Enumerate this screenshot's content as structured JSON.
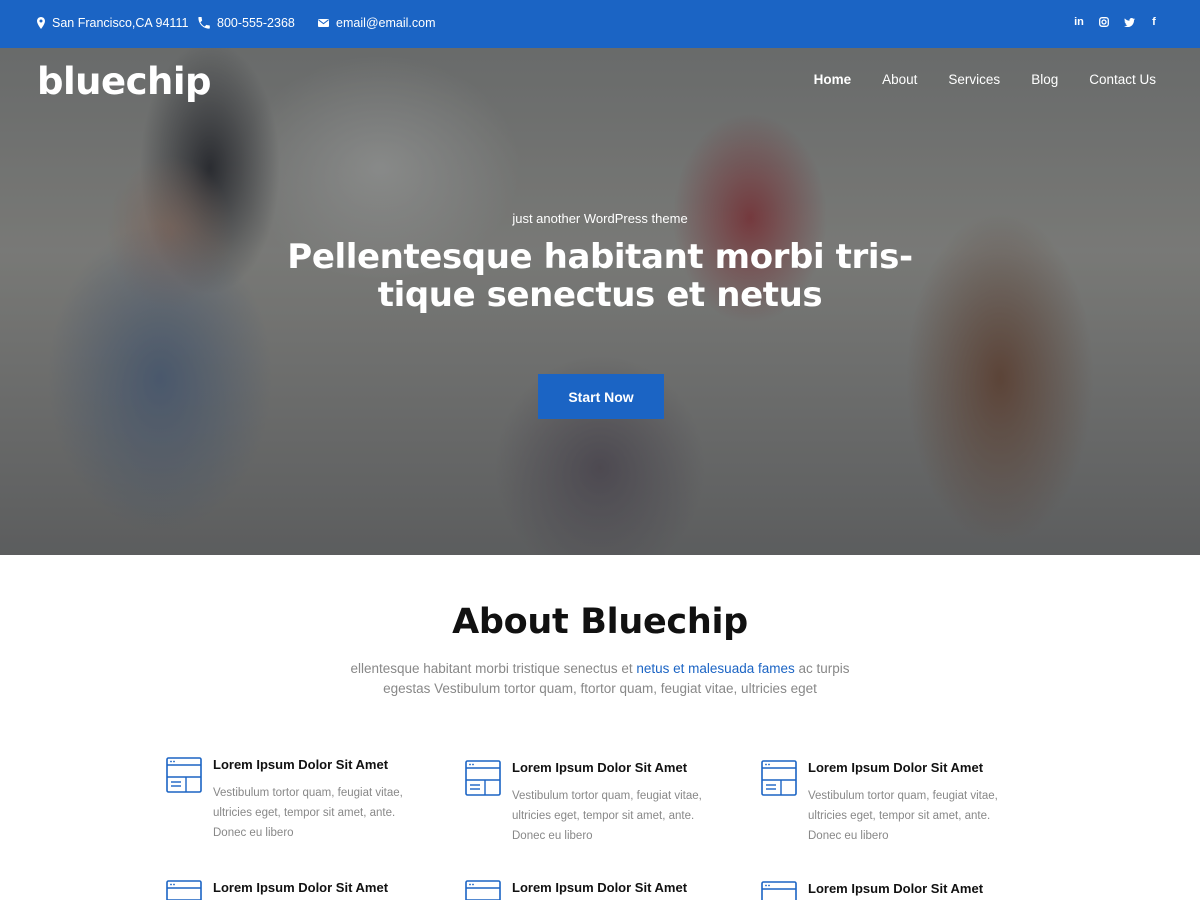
{
  "topbar": {
    "address": "San Francisco,CA 94111",
    "phone": "800-555-2368",
    "email": "email@email.com",
    "social": [
      {
        "icon": "linkedin-icon",
        "glyph": "in"
      },
      {
        "icon": "instagram-icon",
        "glyph": ""
      },
      {
        "icon": "twitter-icon",
        "glyph": ""
      },
      {
        "icon": "facebook-icon",
        "glyph": "f"
      }
    ]
  },
  "header": {
    "logo": "bluechip",
    "nav": [
      "Home",
      "About",
      "Services",
      "Blog",
      "Contact Us"
    ],
    "active_nav": "Home"
  },
  "hero": {
    "tagline": "just another WordPress theme",
    "headline_line1": "Pellentesque habitant morbi tris-",
    "headline_line2": "tique senectus et netus",
    "cta_label": "Start Now"
  },
  "about": {
    "title": "About Bluechip",
    "text_before": "ellentesque habitant morbi tristique senectus et ",
    "text_link": "netus et malesuada fames",
    "text_after": " ac turpis egestas Vestibulum tortor quam, ftortor quam, feugiat vitae, ultricies eget"
  },
  "features": [
    {
      "title": "Lorem Ipsum Dolor Sit Amet",
      "desc": "Vestibulum tortor quam, feugiat vitae, ultricies eget, tempor sit amet, ante. Donec eu libero"
    },
    {
      "title": "Lorem Ipsum Dolor Sit Amet",
      "desc": "Vestibulum tortor quam, feugiat vitae, ultricies eget, tempor sit amet, ante. Donec eu libero"
    },
    {
      "title": "Lorem Ipsum Dolor Sit Amet",
      "desc": "Vestibulum tortor quam, feugiat vitae, ultricies eget, tempor sit amet, ante. Donec eu libero"
    },
    {
      "title": "Lorem Ipsum Dolor Sit Amet",
      "desc": ""
    },
    {
      "title": "Lorem Ipsum Dolor Sit Amet",
      "desc": ""
    },
    {
      "title": "Lorem Ipsum Dolor Sit Amet",
      "desc": ""
    }
  ],
  "colors": {
    "accent": "#1b64c4",
    "text_muted": "#888888"
  }
}
